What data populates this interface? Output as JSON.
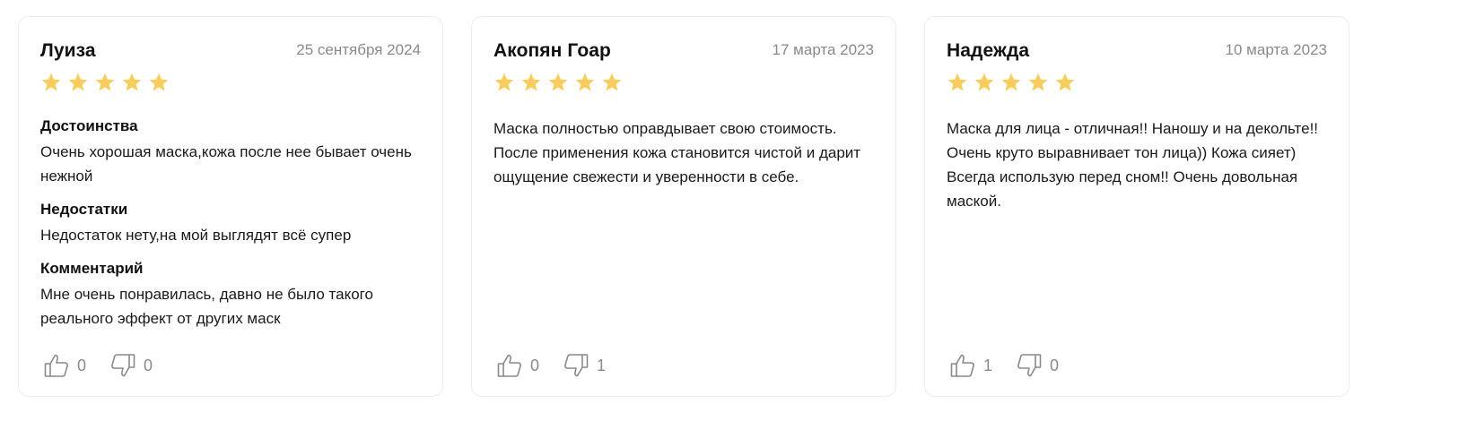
{
  "reviews": [
    {
      "author": "Луиза",
      "date": "25 сентября 2024",
      "rating": 5,
      "sections": [
        {
          "title": "Достоинства",
          "text": "Очень хорошая маска,кожа после нее бывает очень нежной"
        },
        {
          "title": "Недостатки",
          "text": "Недостаток нету,на мой выглядят всё супер"
        },
        {
          "title": "Комментарий",
          "text": "Мне очень понравилась, давно не было такого реального эффект от других маск"
        }
      ],
      "likes": "0",
      "dislikes": "0"
    },
    {
      "author": "Акопян Гоар",
      "date": "17 марта 2023",
      "rating": 5,
      "text": "Маска полностью оправдывает свою стоимость. После применения кожа становится чистой и дарит ощущение свежести и уверенности в себе.",
      "likes": "0",
      "dislikes": "1"
    },
    {
      "author": "Надежда",
      "date": "10 марта 2023",
      "rating": 5,
      "text": "Маска для лица - отличная!! Наношу и на декольте!! Очень круто выравнивает тон лица)) Кожа сияет) Всегда использую перед сном!! Очень довольная маской.",
      "likes": "1",
      "dislikes": "0"
    }
  ],
  "colors": {
    "star": "#f7cd5e",
    "muted": "#8a8a8a",
    "border": "#ececec",
    "icon": "#8a8a8a"
  },
  "icons": {
    "star": "star-icon",
    "like": "thumbs-up-icon",
    "dislike": "thumbs-down-icon"
  }
}
